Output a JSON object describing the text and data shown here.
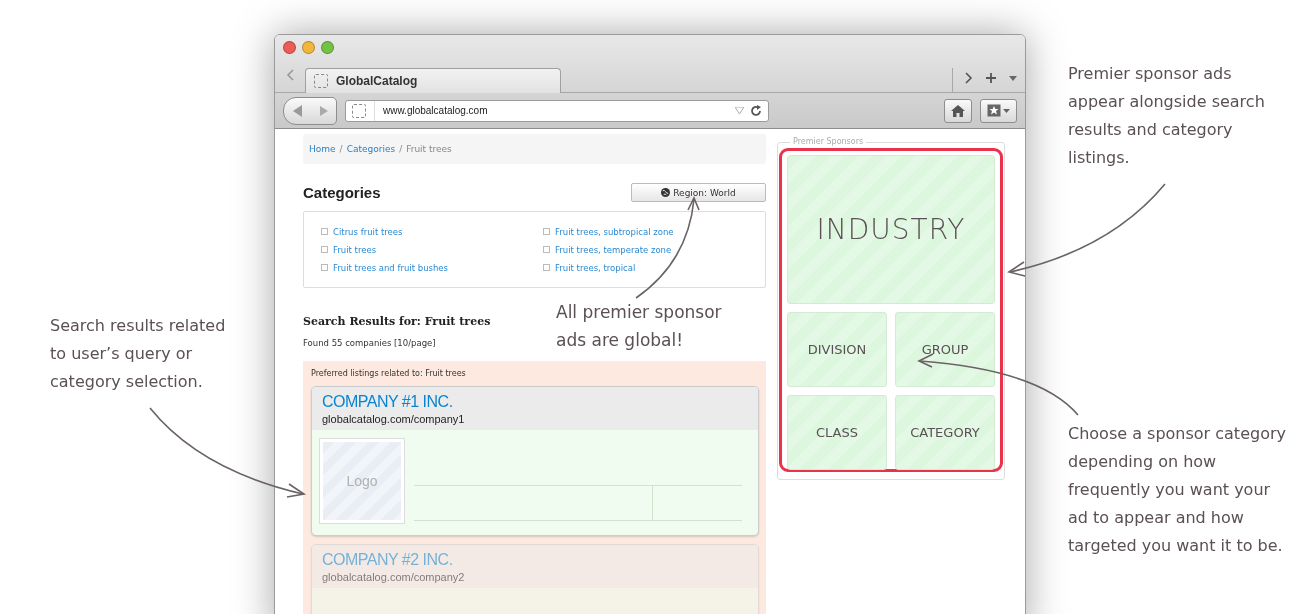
{
  "browser": {
    "tab_title": "GlobalCatalog",
    "url": "www.globalcatalog.com"
  },
  "breadcrumb": {
    "separator": "/",
    "items": [
      {
        "label": "Home",
        "kind": "link"
      },
      {
        "label": "Categories",
        "kind": "link"
      },
      {
        "label": "Fruit trees",
        "kind": "current"
      }
    ]
  },
  "categories": {
    "title": "Categories",
    "region_button": "Region: World",
    "items": [
      "Citrus fruit trees",
      "Fruit trees",
      "Fruit trees and fruit bushes",
      "Fruit trees, subtropical zone",
      "Fruit trees, temperate zone",
      "Fruit trees, tropical"
    ]
  },
  "search_results": {
    "title": "Search Results for: Fruit trees",
    "count": "Found 55 companies [10/page]",
    "preferred_label": "Preferred listings related to: Fruit trees",
    "listings": [
      {
        "name": "COMPANY #1 INC.",
        "url": "globalcatalog.com/company1",
        "logo": "Logo"
      },
      {
        "name": "COMPANY #2 INC.",
        "url": "globalcatalog.com/company2"
      }
    ]
  },
  "sponsors": {
    "legend": "Premier Sponsors",
    "tiles": [
      {
        "label": "INDUSTRY",
        "kind": "large"
      },
      {
        "label": "DIVISION",
        "kind": "small"
      },
      {
        "label": "GROUP",
        "kind": "small"
      },
      {
        "label": "CLASS",
        "kind": "small"
      },
      {
        "label": "CATEGORY",
        "kind": "small"
      }
    ]
  },
  "annotations": [
    {
      "kind": "left",
      "text": "Search results related to user’s query or category selection."
    },
    {
      "kind": "center",
      "text": "All premier sponsor ads are global!"
    },
    {
      "kind": "right_top",
      "text": "Premier sponsor ads appear alongside search results and category listings."
    },
    {
      "kind": "right_bottom",
      "text": "Choose a sponsor category depending on how frequently you want your ad to appear and how targeted you want it to be."
    }
  ]
}
